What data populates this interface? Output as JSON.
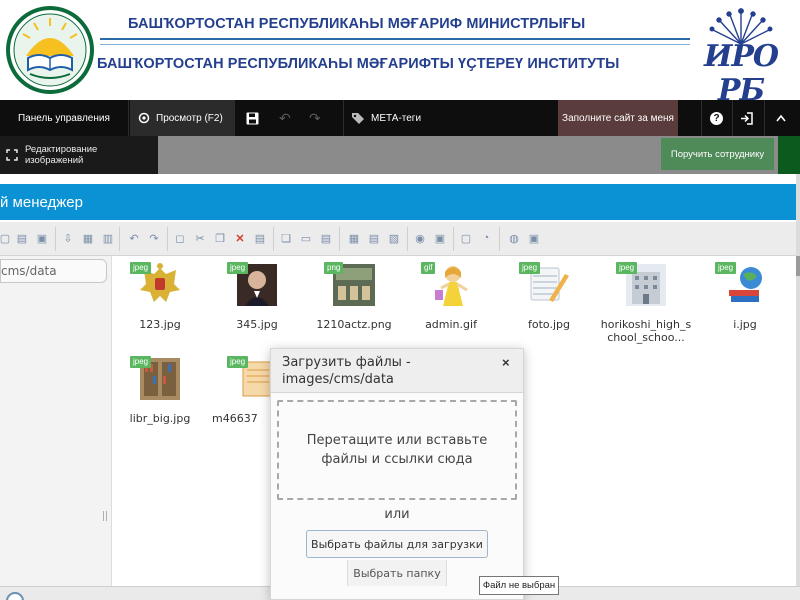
{
  "header": {
    "title_line1": "БАШҠОРТОСТАН РЕСПУБЛИКАҺЫ МӘҒАРИФ МИНИСТРЛЫҒЫ",
    "title_line2": "БАШҠОРТОСТАН РЕСПУБЛИКАҺЫ МӘҒАРИФТЫ ҮҪТЕРЕҮ ИНСТИТУТЫ",
    "logo_text": "ИРО РБ",
    "accent_color": "#233f8e"
  },
  "admin_toolbar": {
    "control_panel": "Панель управления",
    "preview": "Просмотр (F2)",
    "meta_tags": "МЕТА-теги",
    "fill_site": "Заполните сайт за меня",
    "help": "?",
    "bg_color": "#0e0e0e"
  },
  "edit_toolbar": {
    "edit_images": "Редактирование изображений",
    "assign_employee": "Поручить сотруднику"
  },
  "file_manager": {
    "title": "й менеджер",
    "path": "cms/data",
    "accent_color": "#0b92d4",
    "files": [
      {
        "name": "123.jpg",
        "type": "jpeg",
        "icon": "russian-coat-of-arms"
      },
      {
        "name": "345.jpg",
        "type": "jpeg",
        "icon": "portrait-photo"
      },
      {
        "name": "1210actz.png",
        "type": "png",
        "icon": "classroom-photo"
      },
      {
        "name": "admin.gif",
        "type": "gif",
        "icon": "cartoon-girl"
      },
      {
        "name": "foto.jpg",
        "type": "jpeg",
        "icon": "calendar-pencil"
      },
      {
        "name": "horikoshi_high_school_schoo...",
        "type": "jpeg",
        "icon": "school-building"
      },
      {
        "name": "i.jpg",
        "type": "jpeg",
        "icon": "globe-books"
      },
      {
        "name": "libr_big.jpg",
        "type": "jpeg",
        "icon": "library-shelves"
      },
      {
        "name": "m46637",
        "type": "jpeg",
        "icon": "scroll-document"
      }
    ]
  },
  "upload_dialog": {
    "title": "Загрузить файлы - images/cms/data",
    "close": "×",
    "drop_text": "Перетащите или вставьте файлы и ссылки сюда",
    "or": "или",
    "choose_files": "Выбрать файлы для загрузки",
    "choose_folder": "Выбрать папку",
    "tooltip": "Файл не выбран"
  }
}
